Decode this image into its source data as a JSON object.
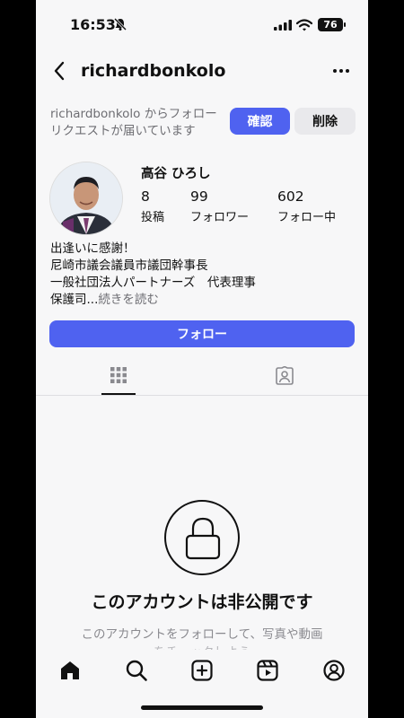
{
  "status_bar": {
    "time": "16:53",
    "battery": "76"
  },
  "header": {
    "username": "richardbonkolo"
  },
  "request": {
    "text": "richardbonkolo からフォローリクエストが届いています",
    "confirm_label": "確認",
    "delete_label": "削除"
  },
  "profile": {
    "display_name": "高谷 ひろし",
    "stats": [
      {
        "value": "8",
        "label": "投稿"
      },
      {
        "value": "99",
        "label": "フォロワー"
      },
      {
        "value": "602",
        "label": "フォロー中"
      }
    ],
    "bio_lines": [
      "出逢いに感謝！",
      "尼崎市議会議員市議団幹事長",
      "一般社団法人パートナーズ　代表理事"
    ],
    "bio_truncated": "保護司...",
    "read_more": "続きを読む"
  },
  "follow_button": "フォロー",
  "private": {
    "title": "このアカウントは非公開です",
    "subtitle": "このアカウントをフォローして、写真や動画",
    "subtitle_cont": "をチェックしよう"
  },
  "colors": {
    "accent": "#4f62f0",
    "secondary_button": "#e9e9ec",
    "background": "#f7f7f8",
    "muted_text": "#6e6e73"
  },
  "icons": {
    "bottom_nav": [
      "home-icon",
      "search-icon",
      "create-icon",
      "reels-icon",
      "profile-icon"
    ],
    "tabs": [
      "grid-icon",
      "tagged-icon"
    ]
  }
}
